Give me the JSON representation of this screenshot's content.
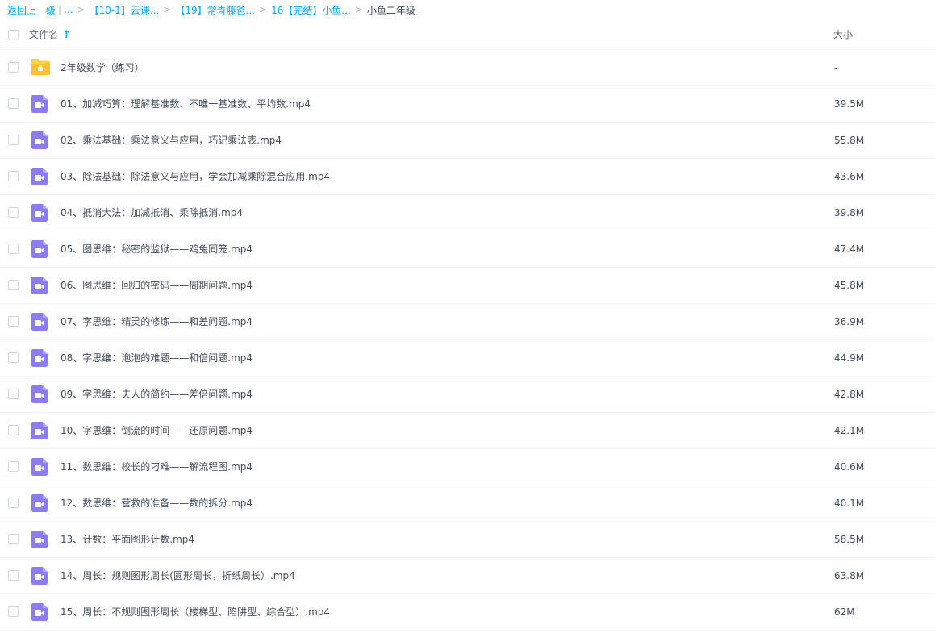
{
  "breadcrumb": {
    "back": "返回上一级",
    "ellipsis": "...",
    "items": [
      "【10-1】云课...",
      "【19】常青藤爸...",
      "16【完结】小鱼..."
    ],
    "current": "小鱼二年级"
  },
  "header": {
    "name_label": "文件名",
    "size_label": "大小"
  },
  "files": [
    {
      "type": "folder",
      "name": "2年级数学（练习）",
      "size": "-"
    },
    {
      "type": "video",
      "name": "01、加减巧算：理解基准数、不唯一基准数、平均数.mp4",
      "size": "39.5M"
    },
    {
      "type": "video",
      "name": "02、乘法基础：乘法意义与应用，巧记乘法表.mp4",
      "size": "55.8M"
    },
    {
      "type": "video",
      "name": "03、除法基础：除法意义与应用，学会加减乘除混合应用.mp4",
      "size": "43.6M"
    },
    {
      "type": "video",
      "name": "04、抵消大法：加减抵消、乘除抵消.mp4",
      "size": "39.8M"
    },
    {
      "type": "video",
      "name": "05、图思维：秘密的监狱——鸡兔同笼.mp4",
      "size": "47.4M"
    },
    {
      "type": "video",
      "name": "06、图思维：回归的密码——周期问题.mp4",
      "size": "45.8M"
    },
    {
      "type": "video",
      "name": "07、字思维：精灵的修炼——和差问题.mp4",
      "size": "36.9M"
    },
    {
      "type": "video",
      "name": "08、字思维：泡泡的难题——和倍问题.mp4",
      "size": "44.9M"
    },
    {
      "type": "video",
      "name": "09、字思维：夫人的简约——差倍问题.mp4",
      "size": "42.8M"
    },
    {
      "type": "video",
      "name": "10、字思维：倒流的时间——还原问题.mp4",
      "size": "42.1M"
    },
    {
      "type": "video",
      "name": "11、数思维：校长的刁难——解流程图.mp4",
      "size": "40.6M"
    },
    {
      "type": "video",
      "name": "12、数思维：营救的准备——数的拆分.mp4",
      "size": "40.1M"
    },
    {
      "type": "video",
      "name": "13、计数：平面图形计数.mp4",
      "size": "58.5M"
    },
    {
      "type": "video",
      "name": "14、周长：规则图形周长(圆形周长，折纸周长）.mp4",
      "size": "63.8M"
    },
    {
      "type": "video",
      "name": "15、周长：不规则图形周长（楼梯型、陷阱型、综合型）.mp4",
      "size": "62M"
    }
  ],
  "colors": {
    "link": "#09aaff",
    "folder": "#ffd04b",
    "video": "#8c7cf0"
  }
}
